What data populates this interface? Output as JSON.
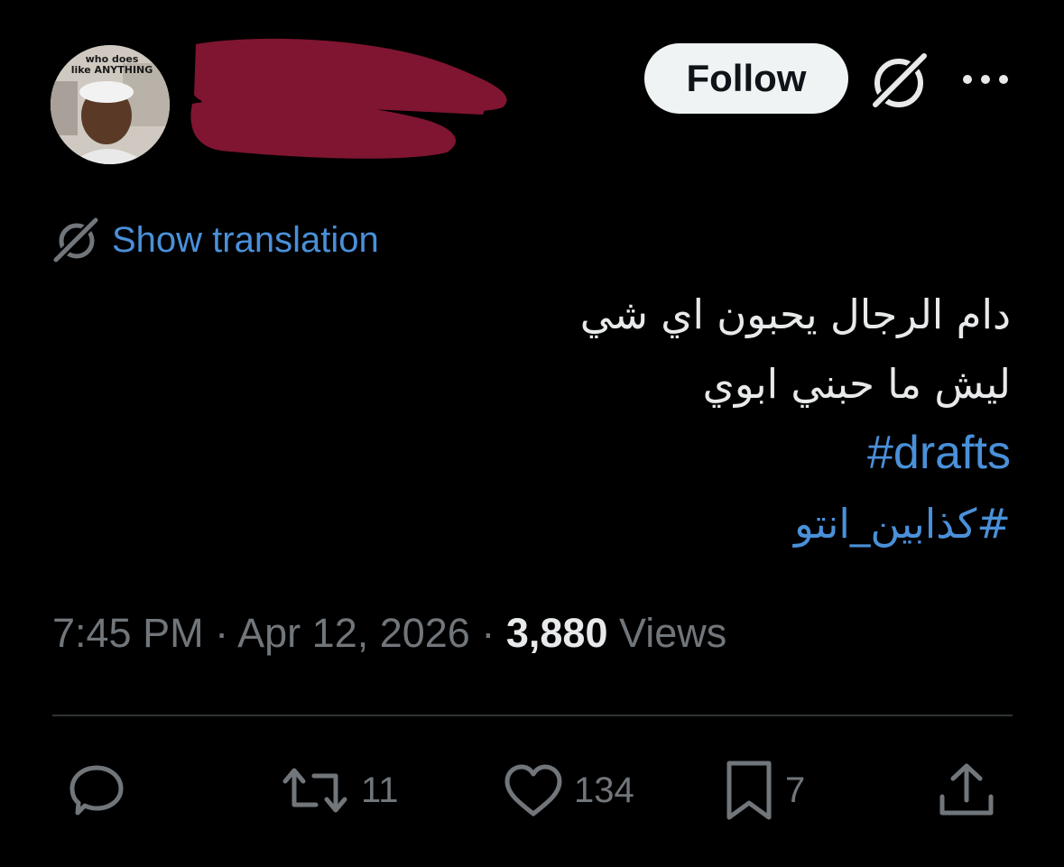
{
  "user": {
    "avatar_caption": "who does\nlike ANYTHING"
  },
  "header": {
    "follow_label": "Follow"
  },
  "translation": {
    "link_label": "Show translation"
  },
  "tweet": {
    "lines": [
      "دام الرجال يحبون اي شي",
      "ليش ما حبني ابوي"
    ],
    "hashtags": [
      "#drafts",
      "#كذابين_انتو"
    ]
  },
  "meta": {
    "time": "7:45 PM",
    "separator": "·",
    "date": "Apr 12, 2026",
    "views_count": "3,880",
    "views_label": "Views"
  },
  "actions": {
    "reply_count": "",
    "retweet_count": "11",
    "like_count": "134",
    "bookmark_count": "7"
  },
  "colors": {
    "background": "#000000",
    "text": "#e7e9ea",
    "muted": "#71767b",
    "link": "#4a90d9",
    "follow_bg": "#eff3f4",
    "redaction": "#7f1530"
  },
  "icons": [
    "grok-icon",
    "more-icon",
    "translate-icon",
    "reply-icon",
    "retweet-icon",
    "like-icon",
    "bookmark-icon",
    "share-icon"
  ]
}
